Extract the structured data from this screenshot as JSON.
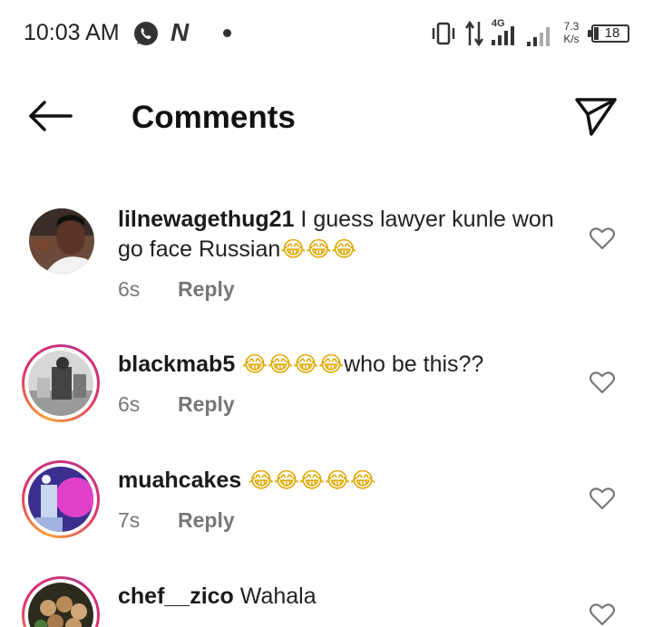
{
  "status_bar": {
    "time": "10:03 AM",
    "network_type": "4G",
    "speed_value": "7.3",
    "speed_unit": "K/s",
    "battery": "18",
    "icons": [
      "whatsapp-icon",
      "n-icon",
      "dot-icon",
      "vibrate-icon",
      "data-arrows-icon",
      "signal-icon",
      "signal-icon"
    ]
  },
  "header": {
    "title": "Comments",
    "back_icon": "arrow-left-icon",
    "share_icon": "paper-plane-icon"
  },
  "comments": [
    {
      "username": "lilnewagethug21",
      "text": " I guess lawyer kunle won go face  Russian",
      "emoji": "😂😂😂",
      "time": "6s",
      "reply_label": "Reply"
    },
    {
      "username": "blackmab5",
      "text_prefix_emoji": " 😂😂😂😂",
      "text": "who be this??",
      "time": "6s",
      "reply_label": "Reply"
    },
    {
      "username": "muahcakes",
      "emoji": " 😂😂😂😂😂",
      "time": "7s",
      "reply_label": "Reply"
    },
    {
      "username": "chef__zico",
      "text": " Wahala"
    }
  ],
  "colors": {
    "ring_start": "#f9a035",
    "ring_end": "#c13584",
    "meta_gray": "#777777"
  }
}
